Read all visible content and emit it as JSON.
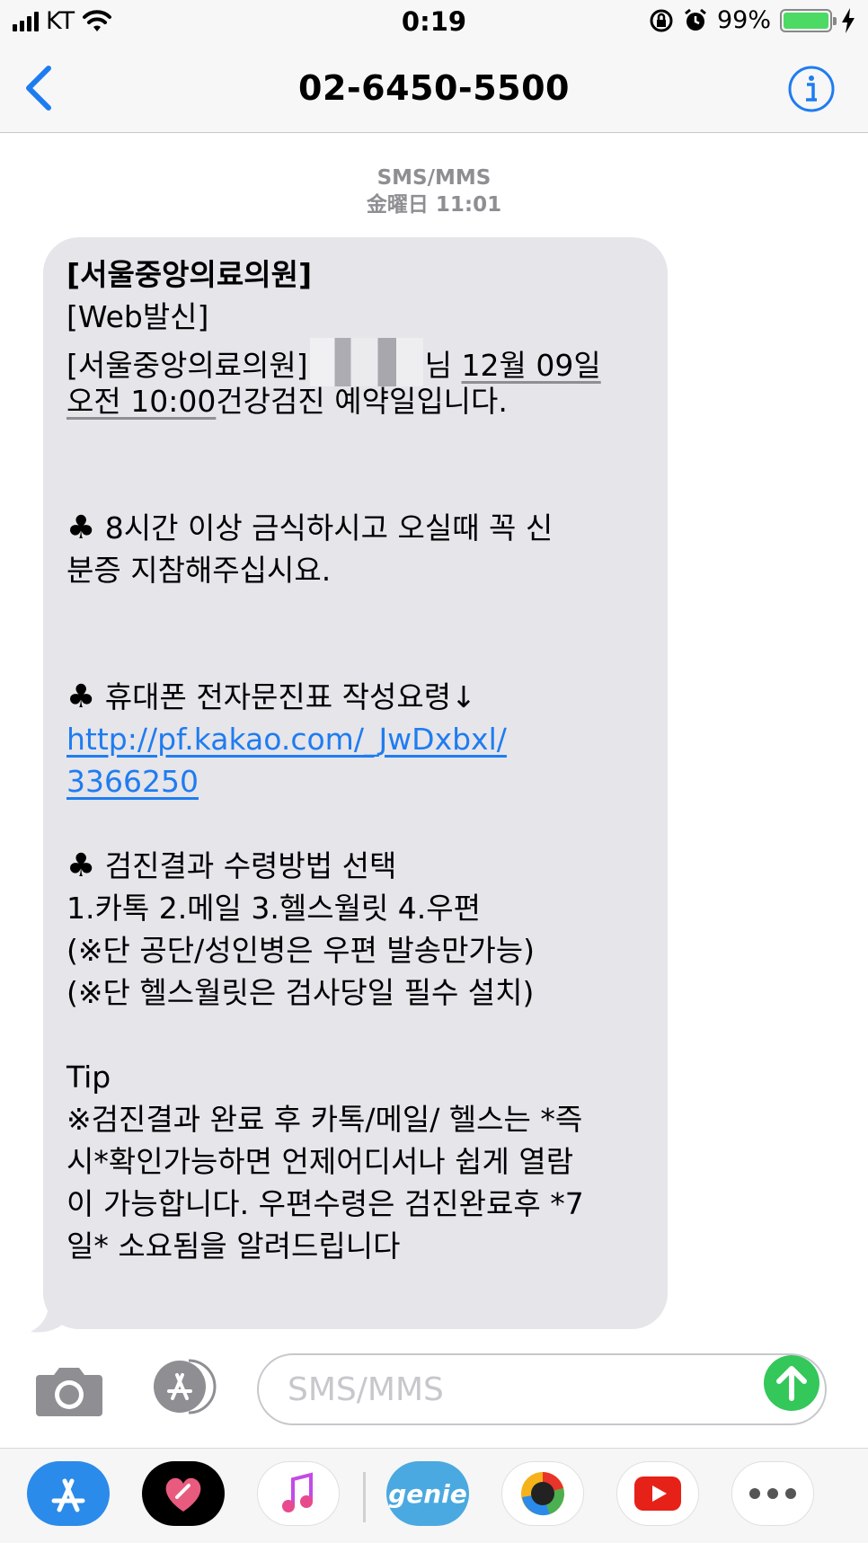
{
  "status_bar": {
    "carrier": "KT",
    "time": "0:19",
    "battery": "99%",
    "battery_level": 0.99
  },
  "nav": {
    "title": "02-6450-5500"
  },
  "conversation": {
    "service": "SMS/MMS",
    "timestamp": "金曜日 11:01"
  },
  "message": {
    "header": "[서울중앙의료의원]",
    "web_tag": "[Web발신]",
    "clinic": "[서울중앙의료의원]",
    "honorific": "님",
    "date_part1": "12월 09일",
    "date_part2": "오전 10:00",
    "appointment_text": "건강검진 예약일입니다.",
    "club": "♣",
    "fasting_line1": " 8시간 이상 금식하시고 오실때 꼭 신",
    "fasting_line2": "분증 지참해주십시요.",
    "survey_title": " 휴대폰 전자문진표 작성요령↓",
    "link_line1": "http://pf.kakao.com/_JwDxbxl/",
    "link_line2": "3366250",
    "result_title": " 검진결과 수령방법 선택",
    "options": "1.카톡 2.메일 3.헬스월릿 4.우편",
    "note1": "(※단 공단/성인병은 우편 발송만가능)",
    "note2": "(※단 헬스월릿은 검사당일 필수 설치)",
    "tip_label": "Tip",
    "tip_line1": "※검진결과 완료 후 카톡/메일/ 헬스는 *즉",
    "tip_line2": "시*확인가능하면 언제어디서나 쉽게 열람",
    "tip_line3": "이 가능합니다. 우편수령은 검진완료후 *7",
    "tip_line4": "일* 소요됨을 알려드립니다"
  },
  "input": {
    "placeholder": "SMS/MMS"
  },
  "drawer": {
    "apps": [
      "app-store",
      "health",
      "music",
      "genie",
      "game-center",
      "youtube",
      "more"
    ],
    "genie_label": "genie"
  },
  "colors": {
    "accent": "#1f7cf0",
    "bubble": "#e5e5ea",
    "send": "#34c759",
    "battery": "#4cd964"
  }
}
